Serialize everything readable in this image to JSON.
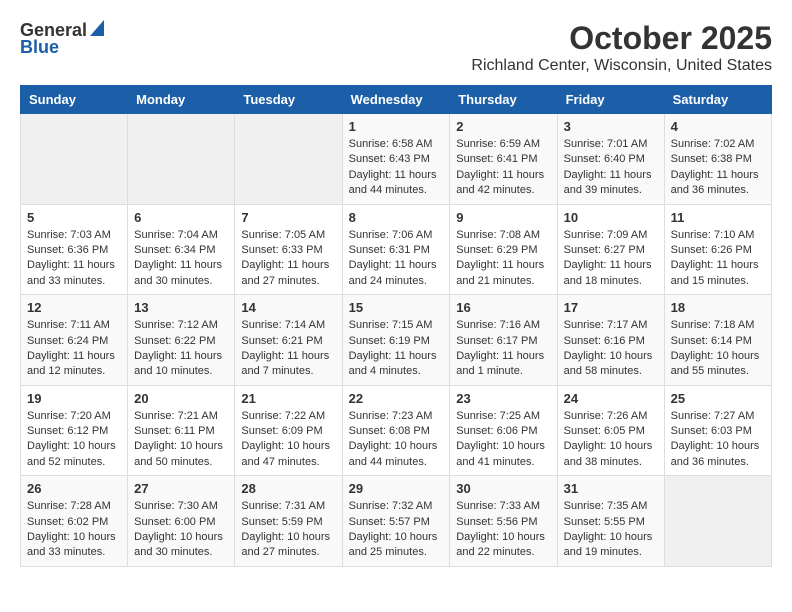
{
  "header": {
    "logo_general": "General",
    "logo_blue": "Blue",
    "month_title": "October 2025",
    "location": "Richland Center, Wisconsin, United States"
  },
  "weekdays": [
    "Sunday",
    "Monday",
    "Tuesday",
    "Wednesday",
    "Thursday",
    "Friday",
    "Saturday"
  ],
  "weeks": [
    [
      {
        "day": "",
        "info": ""
      },
      {
        "day": "",
        "info": ""
      },
      {
        "day": "",
        "info": ""
      },
      {
        "day": "1",
        "info": "Sunrise: 6:58 AM\nSunset: 6:43 PM\nDaylight: 11 hours\nand 44 minutes."
      },
      {
        "day": "2",
        "info": "Sunrise: 6:59 AM\nSunset: 6:41 PM\nDaylight: 11 hours\nand 42 minutes."
      },
      {
        "day": "3",
        "info": "Sunrise: 7:01 AM\nSunset: 6:40 PM\nDaylight: 11 hours\nand 39 minutes."
      },
      {
        "day": "4",
        "info": "Sunrise: 7:02 AM\nSunset: 6:38 PM\nDaylight: 11 hours\nand 36 minutes."
      }
    ],
    [
      {
        "day": "5",
        "info": "Sunrise: 7:03 AM\nSunset: 6:36 PM\nDaylight: 11 hours\nand 33 minutes."
      },
      {
        "day": "6",
        "info": "Sunrise: 7:04 AM\nSunset: 6:34 PM\nDaylight: 11 hours\nand 30 minutes."
      },
      {
        "day": "7",
        "info": "Sunrise: 7:05 AM\nSunset: 6:33 PM\nDaylight: 11 hours\nand 27 minutes."
      },
      {
        "day": "8",
        "info": "Sunrise: 7:06 AM\nSunset: 6:31 PM\nDaylight: 11 hours\nand 24 minutes."
      },
      {
        "day": "9",
        "info": "Sunrise: 7:08 AM\nSunset: 6:29 PM\nDaylight: 11 hours\nand 21 minutes."
      },
      {
        "day": "10",
        "info": "Sunrise: 7:09 AM\nSunset: 6:27 PM\nDaylight: 11 hours\nand 18 minutes."
      },
      {
        "day": "11",
        "info": "Sunrise: 7:10 AM\nSunset: 6:26 PM\nDaylight: 11 hours\nand 15 minutes."
      }
    ],
    [
      {
        "day": "12",
        "info": "Sunrise: 7:11 AM\nSunset: 6:24 PM\nDaylight: 11 hours\nand 12 minutes."
      },
      {
        "day": "13",
        "info": "Sunrise: 7:12 AM\nSunset: 6:22 PM\nDaylight: 11 hours\nand 10 minutes."
      },
      {
        "day": "14",
        "info": "Sunrise: 7:14 AM\nSunset: 6:21 PM\nDaylight: 11 hours\nand 7 minutes."
      },
      {
        "day": "15",
        "info": "Sunrise: 7:15 AM\nSunset: 6:19 PM\nDaylight: 11 hours\nand 4 minutes."
      },
      {
        "day": "16",
        "info": "Sunrise: 7:16 AM\nSunset: 6:17 PM\nDaylight: 11 hours\nand 1 minute."
      },
      {
        "day": "17",
        "info": "Sunrise: 7:17 AM\nSunset: 6:16 PM\nDaylight: 10 hours\nand 58 minutes."
      },
      {
        "day": "18",
        "info": "Sunrise: 7:18 AM\nSunset: 6:14 PM\nDaylight: 10 hours\nand 55 minutes."
      }
    ],
    [
      {
        "day": "19",
        "info": "Sunrise: 7:20 AM\nSunset: 6:12 PM\nDaylight: 10 hours\nand 52 minutes."
      },
      {
        "day": "20",
        "info": "Sunrise: 7:21 AM\nSunset: 6:11 PM\nDaylight: 10 hours\nand 50 minutes."
      },
      {
        "day": "21",
        "info": "Sunrise: 7:22 AM\nSunset: 6:09 PM\nDaylight: 10 hours\nand 47 minutes."
      },
      {
        "day": "22",
        "info": "Sunrise: 7:23 AM\nSunset: 6:08 PM\nDaylight: 10 hours\nand 44 minutes."
      },
      {
        "day": "23",
        "info": "Sunrise: 7:25 AM\nSunset: 6:06 PM\nDaylight: 10 hours\nand 41 minutes."
      },
      {
        "day": "24",
        "info": "Sunrise: 7:26 AM\nSunset: 6:05 PM\nDaylight: 10 hours\nand 38 minutes."
      },
      {
        "day": "25",
        "info": "Sunrise: 7:27 AM\nSunset: 6:03 PM\nDaylight: 10 hours\nand 36 minutes."
      }
    ],
    [
      {
        "day": "26",
        "info": "Sunrise: 7:28 AM\nSunset: 6:02 PM\nDaylight: 10 hours\nand 33 minutes."
      },
      {
        "day": "27",
        "info": "Sunrise: 7:30 AM\nSunset: 6:00 PM\nDaylight: 10 hours\nand 30 minutes."
      },
      {
        "day": "28",
        "info": "Sunrise: 7:31 AM\nSunset: 5:59 PM\nDaylight: 10 hours\nand 27 minutes."
      },
      {
        "day": "29",
        "info": "Sunrise: 7:32 AM\nSunset: 5:57 PM\nDaylight: 10 hours\nand 25 minutes."
      },
      {
        "day": "30",
        "info": "Sunrise: 7:33 AM\nSunset: 5:56 PM\nDaylight: 10 hours\nand 22 minutes."
      },
      {
        "day": "31",
        "info": "Sunrise: 7:35 AM\nSunset: 5:55 PM\nDaylight: 10 hours\nand 19 minutes."
      },
      {
        "day": "",
        "info": ""
      }
    ]
  ]
}
